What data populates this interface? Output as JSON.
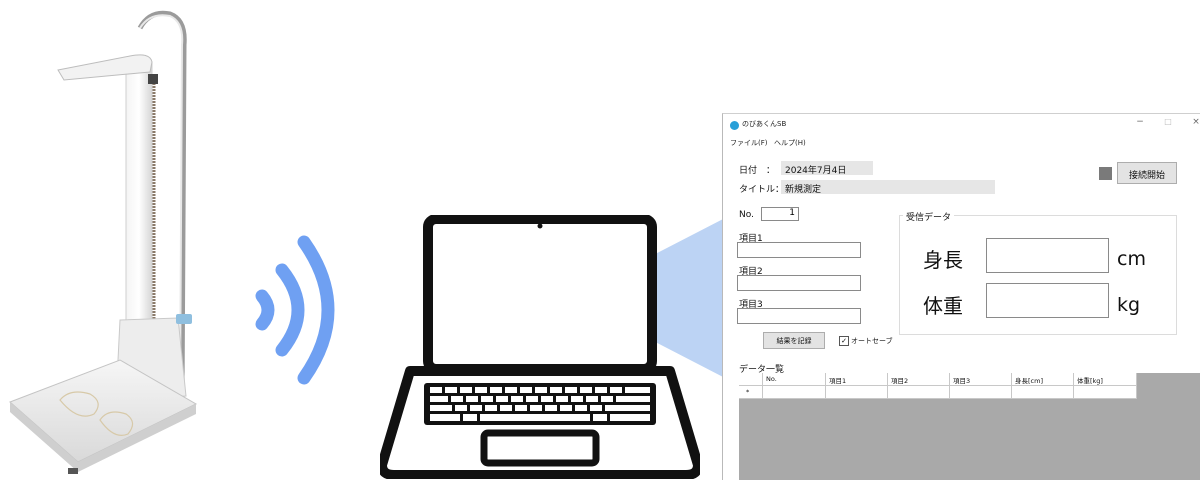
{
  "app": {
    "title": "のびあくんSB",
    "minimize": "−",
    "maximize": "□",
    "close": "×"
  },
  "menu": [
    "ファイル(F)",
    "ヘルプ(H)"
  ],
  "header": {
    "date_label": "日付　：",
    "date_value": "2024年7月4日",
    "title_label": "タイトル：",
    "title_value": "新規測定",
    "connect_button": "接続開始"
  },
  "form": {
    "no_label": "No.",
    "no_value": "1",
    "item1_label": "項目1",
    "item2_label": "項目2",
    "item3_label": "項目3",
    "record_button": "結果を記録",
    "autosave_label": "オートセーブ",
    "autosave_checked": true
  },
  "received": {
    "group_label": "受信データ",
    "height_label": "身長",
    "height_unit": "cm",
    "weight_label": "体重",
    "weight_unit": "kg"
  },
  "data_list": {
    "label": "データ一覧",
    "columns": [
      "No.",
      "項目1",
      "項目2",
      "項目3",
      "身長[cm]",
      "体重[kg]"
    ],
    "new_row_marker": "*"
  },
  "colors": {
    "wifi_blue": "#6fa0f2",
    "beam_blue": "#bcd3f4",
    "laptop_black": "#111111",
    "grid_gray": "#a9a9a9",
    "app_icon": "#2aa0d8"
  }
}
